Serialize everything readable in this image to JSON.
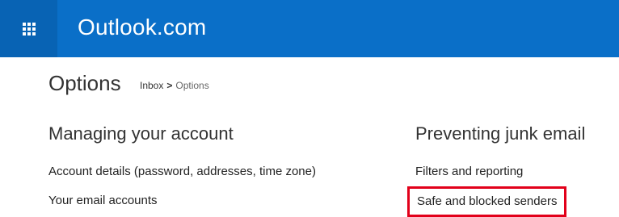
{
  "header": {
    "brand": "Outlook.com",
    "app_launcher_icon": "waffle-grid-icon",
    "background_color": "#0a6fc8",
    "launcher_background_color": "#0863b4"
  },
  "page": {
    "title": "Options",
    "breadcrumb": {
      "inbox": "Inbox",
      "separator": ">",
      "current": "Options"
    }
  },
  "sections": {
    "managing_account": {
      "heading": "Managing your account",
      "links": [
        "Account details (password, addresses, time zone)",
        "Your email accounts"
      ]
    },
    "preventing_junk": {
      "heading": "Preventing junk email",
      "links": [
        "Filters and reporting",
        "Safe and blocked senders"
      ],
      "highlight_color": "#e2001a"
    }
  }
}
